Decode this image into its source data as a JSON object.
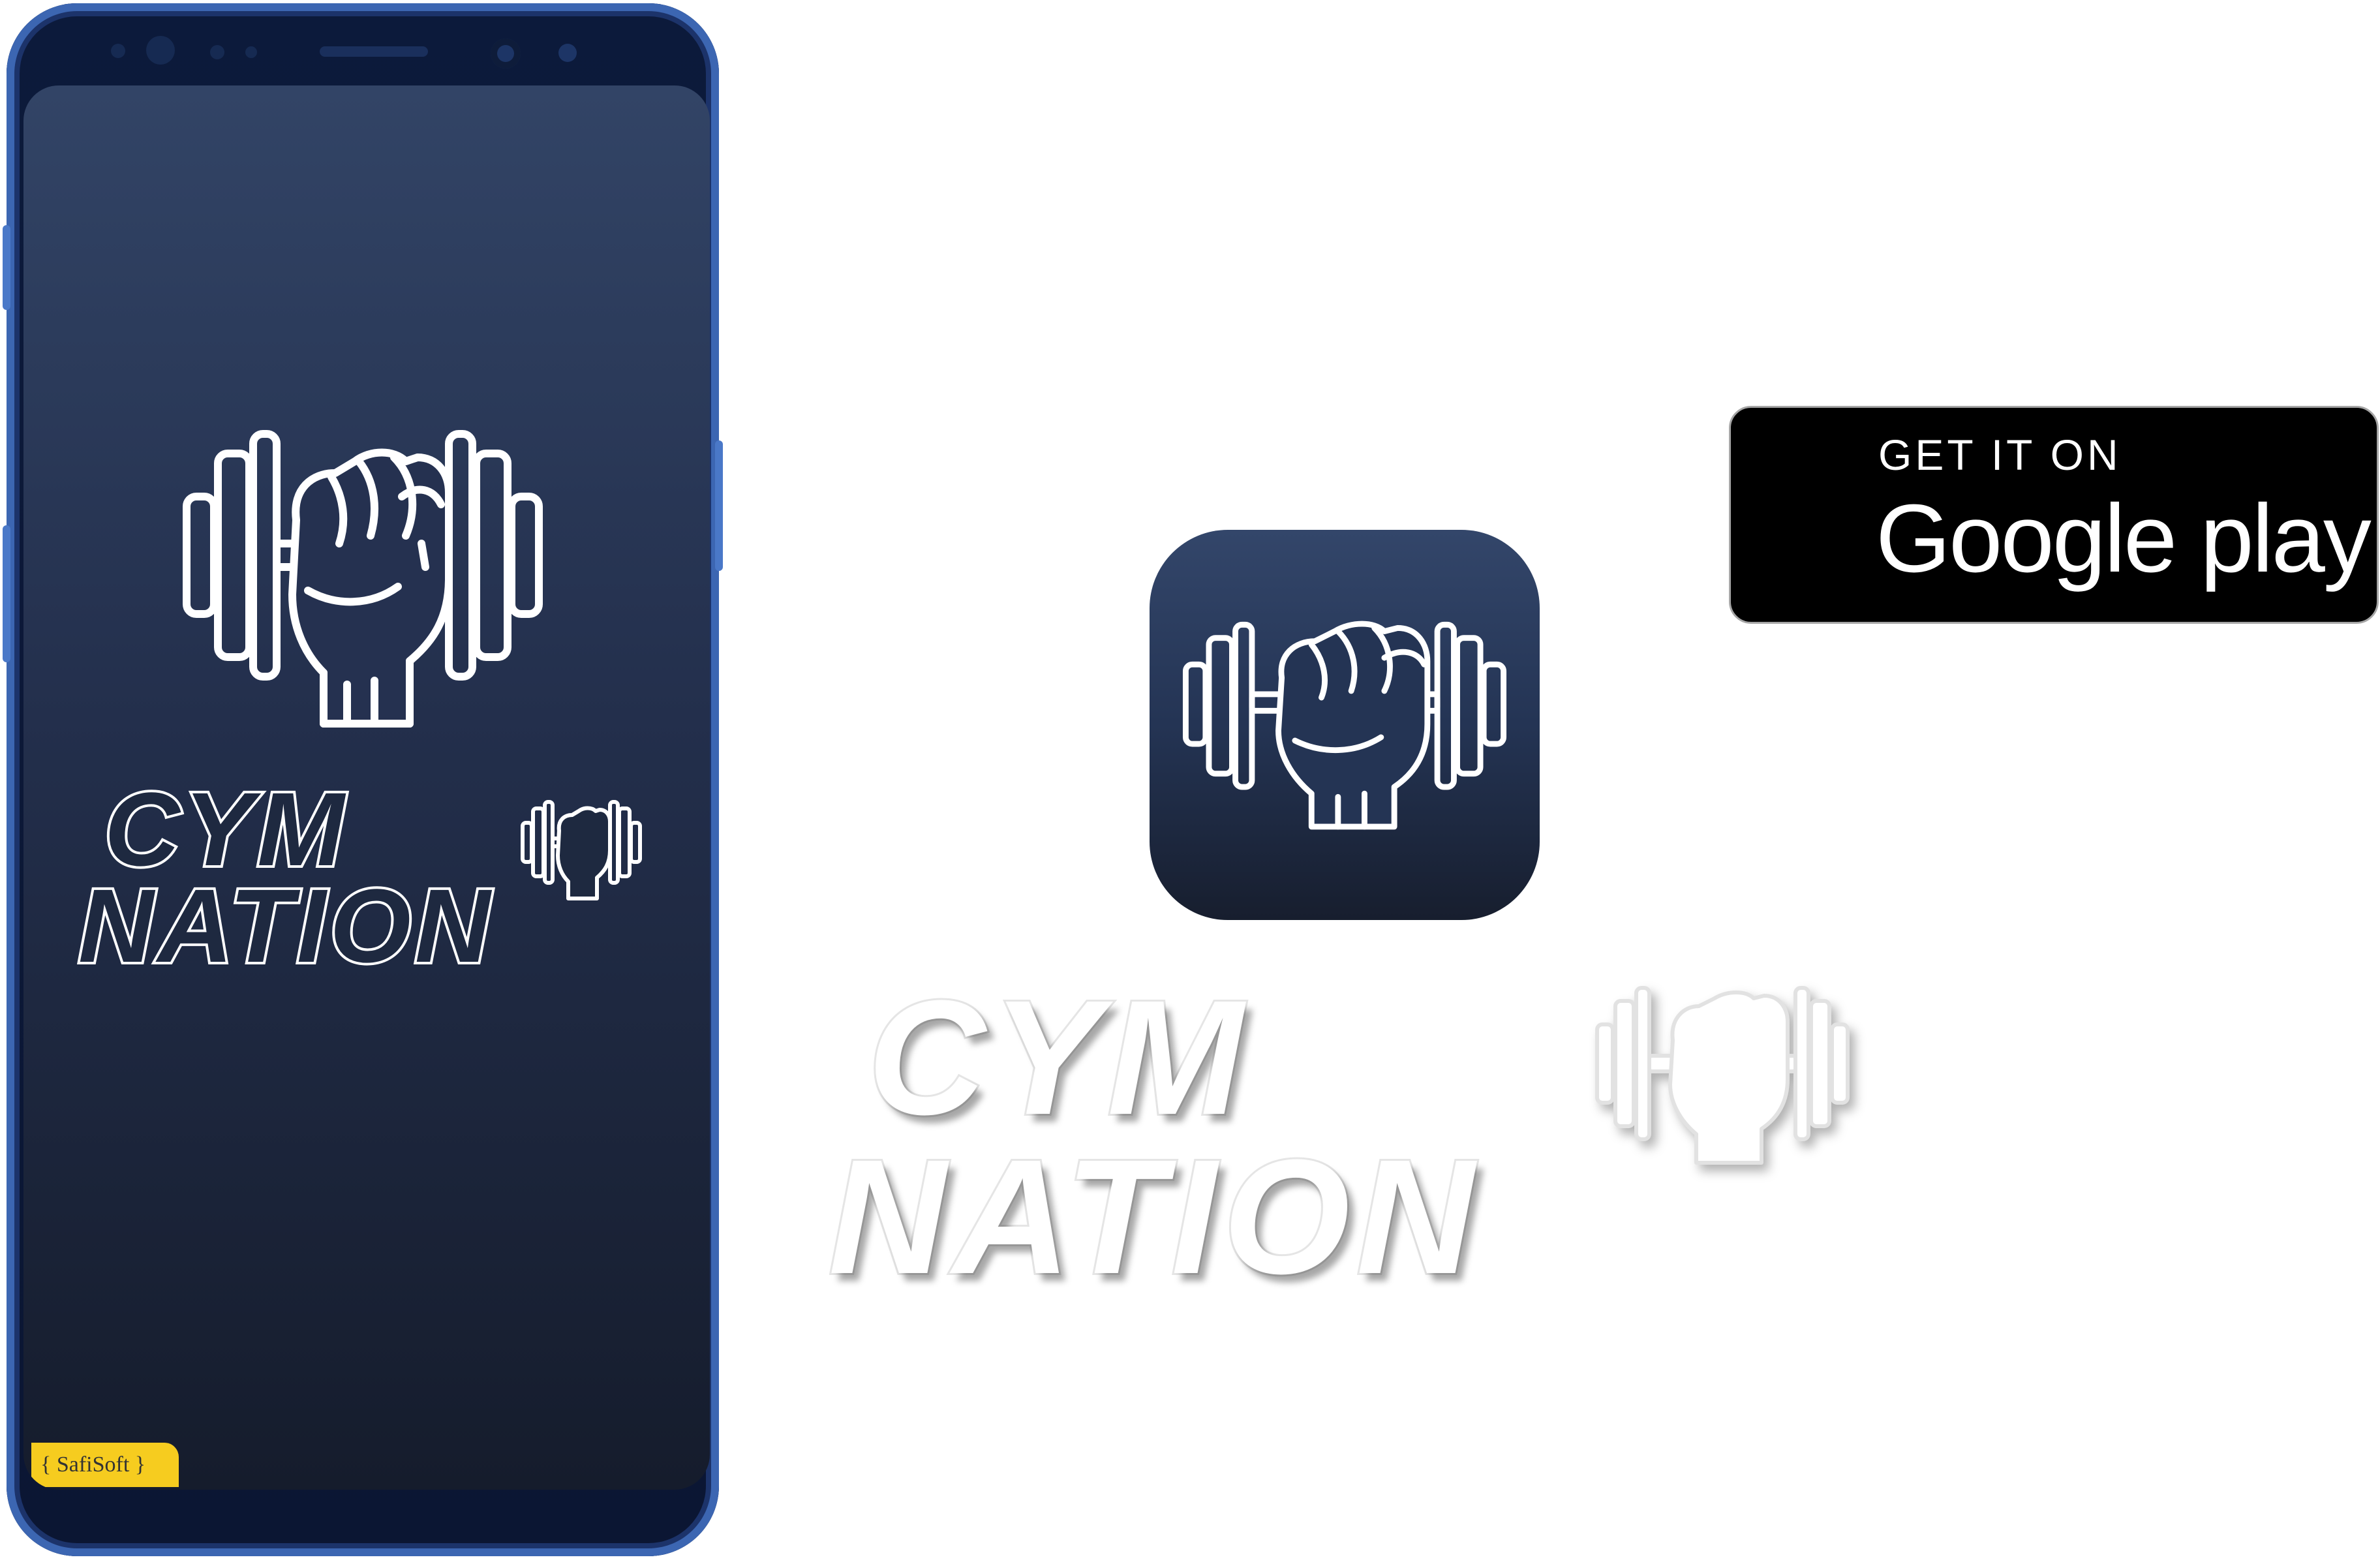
{
  "app": {
    "name_line1": "CYM",
    "name_line2": "NATION",
    "developer_tag": "{ SafiSoft }",
    "theme_colors": {
      "navy_top": "#324466",
      "navy_bottom": "#151c2c",
      "phone_frame": "#3c66b2",
      "tag_yellow": "#f6cc1f"
    }
  },
  "icons": {
    "logo": "dumbbell-fist-icon",
    "app_icon": "app-icon"
  },
  "store_badge": {
    "top_text": "GET IT ON",
    "store_name": "Google play",
    "background": "#000000"
  }
}
